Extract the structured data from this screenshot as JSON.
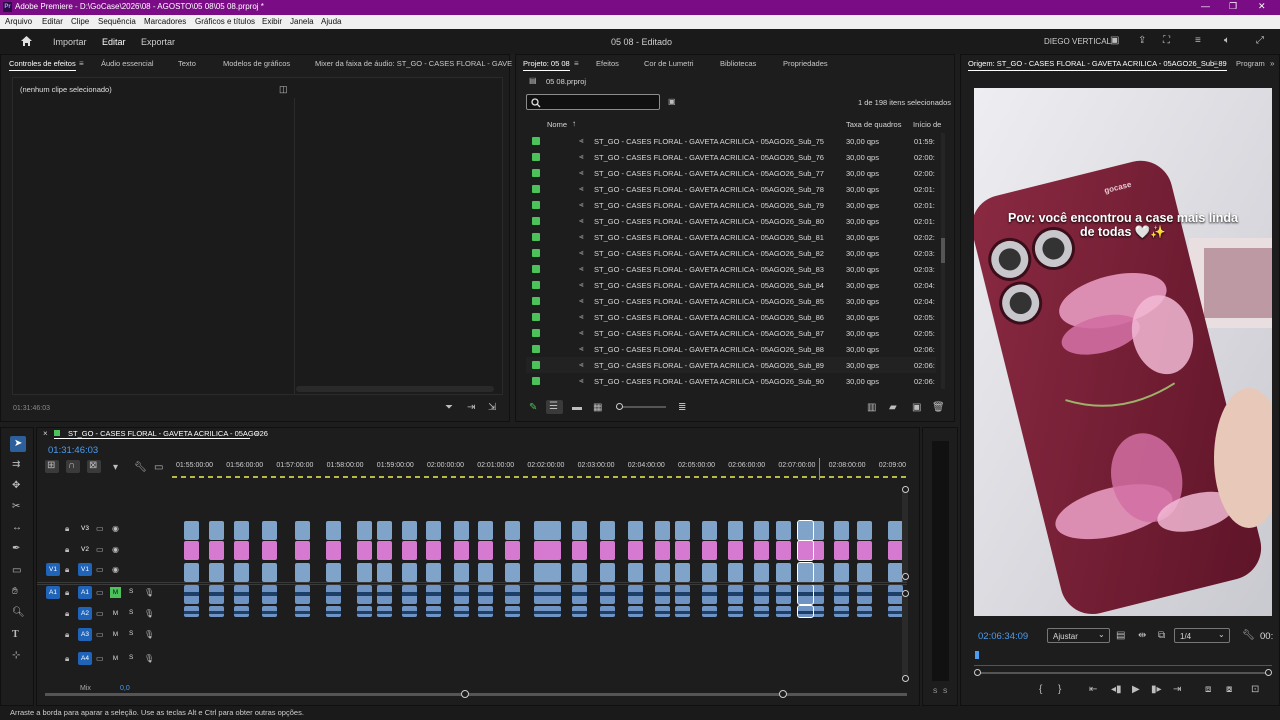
{
  "titlebar": {
    "app": "Pr",
    "title": "Adobe Premiere - D:\\GoCase\\2026\\08 - AGOSTO\\05 08\\05 08.prproj *"
  },
  "menu": [
    "Arquivo",
    "Editar",
    "Clipe",
    "Sequência",
    "Marcadores",
    "Gráficos e títulos",
    "Exibir",
    "Janela",
    "Ajuda"
  ],
  "header": {
    "home_icon": "home-icon",
    "import": "Importar",
    "edit": "Editar",
    "export": "Exportar",
    "project": "05 08 - Editado",
    "workspace": "DIEGO VERTICAL"
  },
  "effects_panel": {
    "tabs": [
      "Controles de efeitos",
      "Áudio essencial",
      "Texto",
      "Modelos de gráficos",
      "Mixer da faixa de áudio: ST_GO - CASES FLORAL - GAVE"
    ],
    "empty": "(nenhum clipe selecionado)",
    "timecode": "01:31:46:03"
  },
  "project_panel": {
    "tabs": [
      "Projeto: 05 08",
      "Efeitos",
      "Cor de Lumetri",
      "Bibliotecas",
      "Propriedades"
    ],
    "file": "05 08.prproj",
    "search_placeholder": "",
    "selection_count": "1 de 198 itens selecionados",
    "columns": [
      "Nome",
      "Taxa de quadros",
      "Início de"
    ],
    "items": [
      {
        "name": "ST_GO - CASES FLORAL - GAVETA ACRILICA - 05AGO26_Sub_75",
        "rate": "30,00 qps",
        "start": "01:59:"
      },
      {
        "name": "ST_GO - CASES FLORAL - GAVETA ACRILICA - 05AGO26_Sub_76",
        "rate": "30,00 qps",
        "start": "02:00:"
      },
      {
        "name": "ST_GO - CASES FLORAL - GAVETA ACRILICA - 05AGO26_Sub_77",
        "rate": "30,00 qps",
        "start": "02:00:"
      },
      {
        "name": "ST_GO - CASES FLORAL - GAVETA ACRILICA - 05AGO26_Sub_78",
        "rate": "30,00 qps",
        "start": "02:01:"
      },
      {
        "name": "ST_GO - CASES FLORAL - GAVETA ACRILICA - 05AGO26_Sub_79",
        "rate": "30,00 qps",
        "start": "02:01:"
      },
      {
        "name": "ST_GO - CASES FLORAL - GAVETA ACRILICA - 05AGO26_Sub_80",
        "rate": "30,00 qps",
        "start": "02:01:"
      },
      {
        "name": "ST_GO - CASES FLORAL - GAVETA ACRILICA - 05AGO26_Sub_81",
        "rate": "30,00 qps",
        "start": "02:02:"
      },
      {
        "name": "ST_GO - CASES FLORAL - GAVETA ACRILICA - 05AGO26_Sub_82",
        "rate": "30,00 qps",
        "start": "02:03:"
      },
      {
        "name": "ST_GO - CASES FLORAL - GAVETA ACRILICA - 05AGO26_Sub_83",
        "rate": "30,00 qps",
        "start": "02:03:"
      },
      {
        "name": "ST_GO - CASES FLORAL - GAVETA ACRILICA - 05AGO26_Sub_84",
        "rate": "30,00 qps",
        "start": "02:04:"
      },
      {
        "name": "ST_GO - CASES FLORAL - GAVETA ACRILICA - 05AGO26_Sub_85",
        "rate": "30,00 qps",
        "start": "02:04:"
      },
      {
        "name": "ST_GO - CASES FLORAL - GAVETA ACRILICA - 05AGO26_Sub_86",
        "rate": "30,00 qps",
        "start": "02:05:"
      },
      {
        "name": "ST_GO - CASES FLORAL - GAVETA ACRILICA - 05AGO26_Sub_87",
        "rate": "30,00 qps",
        "start": "02:05:"
      },
      {
        "name": "ST_GO - CASES FLORAL - GAVETA ACRILICA - 05AGO26_Sub_88",
        "rate": "30,00 qps",
        "start": "02:06:"
      },
      {
        "name": "ST_GO - CASES FLORAL - GAVETA ACRILICA - 05AGO26_Sub_89",
        "rate": "30,00 qps",
        "start": "02:06:"
      },
      {
        "name": "ST_GO - CASES FLORAL - GAVETA ACRILICA - 05AGO26_Sub_90",
        "rate": "30,00 qps",
        "start": "02:06:"
      }
    ]
  },
  "source_monitor": {
    "tabs": [
      "Origem: ST_GO - CASES FLORAL - GAVETA ACRILICA - 05AGO26_Sub_89",
      "Program"
    ],
    "caption": "Pov: você encontrou a case mais linda de todas 🤍✨",
    "brand": "gocase",
    "timecode": "02:06:34:09",
    "fit": "Ajustar",
    "resolution": "1/4",
    "tc_right": "00:"
  },
  "timeline": {
    "sequence": "ST_GO - CASES FLORAL - GAVETA ACRILICA - 05AGO26",
    "timecode": "01:31:46:03",
    "ruler": [
      "01:55:00:00",
      "01:56:00:00",
      "01:57:00:00",
      "01:58:00:00",
      "01:59:00:00",
      "02:00:00:00",
      "02:01:00:00",
      "02:02:00:00",
      "02:03:00:00",
      "02:04:00:00",
      "02:05:00:00",
      "02:06:00:00",
      "02:07:00:00",
      "02:08:00:00",
      "02:09:00"
    ],
    "tracks": [
      "V3",
      "V2",
      "V1",
      "A1",
      "A2",
      "A3",
      "A4"
    ],
    "mix": "Mix",
    "mix_value": "0,0",
    "meter_labels": [
      "S",
      "S"
    ]
  },
  "statusbar": "Arraste a borda para aparar a seleção. Use as teclas Alt e Ctrl para obter outras opções."
}
